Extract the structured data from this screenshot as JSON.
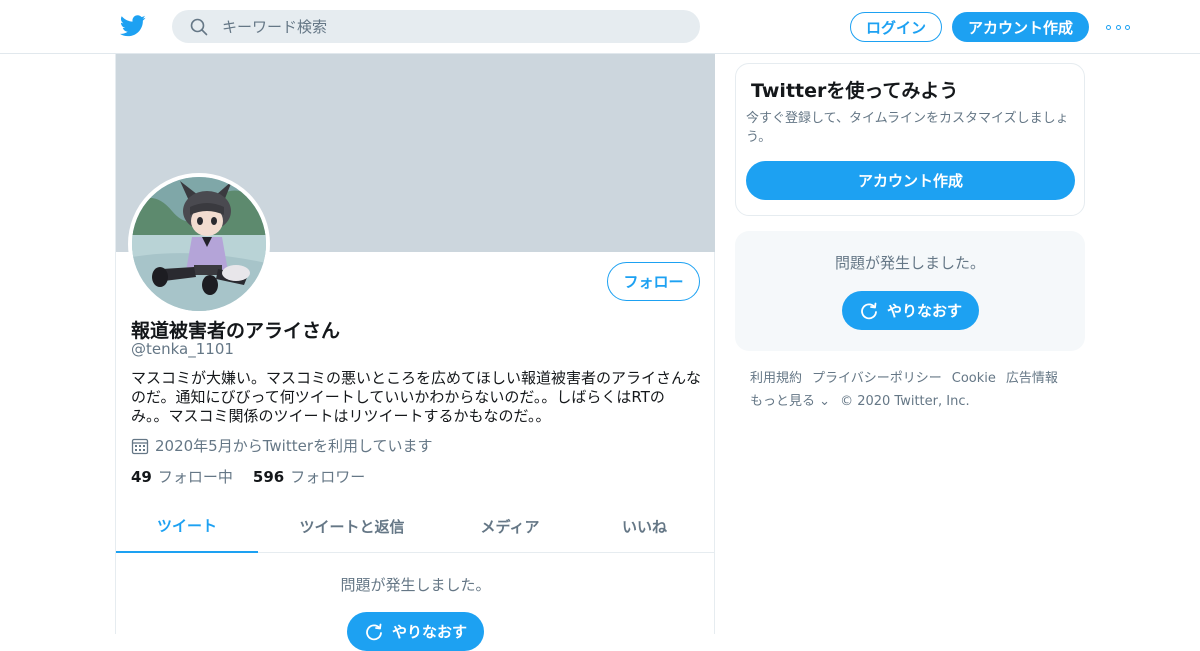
{
  "header": {
    "search_placeholder": "キーワード検索",
    "login_label": "ログイン",
    "signup_label": "アカウント作成"
  },
  "profile": {
    "display_name": "報道被害者のアライさん",
    "handle": "@tenka_1101",
    "bio": "マスコミが大嫌い。マスコミの悪いところを広めてほしい報道被害者のアライさんなのだ。通知にびびって何ツイートしていいかわからないのだ。。しばらくはRTのみ。。マスコミ関係のツイートはリツイートするかもなのだ。。",
    "joined": "2020年5月からTwitterを利用しています",
    "follow_label": "フォロー",
    "following_count": "49",
    "following_label": "フォロー中",
    "followers_count": "596",
    "followers_label": "フォロワー"
  },
  "tabs": [
    {
      "label": "ツイート",
      "active": true
    },
    {
      "label": "ツイートと返信",
      "active": false
    },
    {
      "label": "メディア",
      "active": false
    },
    {
      "label": "いいね",
      "active": false
    }
  ],
  "timeline": {
    "error_text": "問題が発生しました。",
    "retry_label": "やりなおす"
  },
  "sidebar": {
    "try_title": "Twitterを使ってみよう",
    "try_desc": "今すぐ登録して、タイムラインをカスタマイズしましょう。",
    "try_button": "アカウント作成",
    "error_text": "問題が発生しました。",
    "retry_label": "やりなおす"
  },
  "footer": {
    "links": [
      "利用規約",
      "プライバシーポリシー",
      "Cookie",
      "広告情報"
    ],
    "more_label": "もっと見る",
    "copyright": "© 2020 Twitter, Inc."
  },
  "colors": {
    "accent": "#1da1f2",
    "banner": "#ccd6dd",
    "muted_text": "#657786"
  }
}
